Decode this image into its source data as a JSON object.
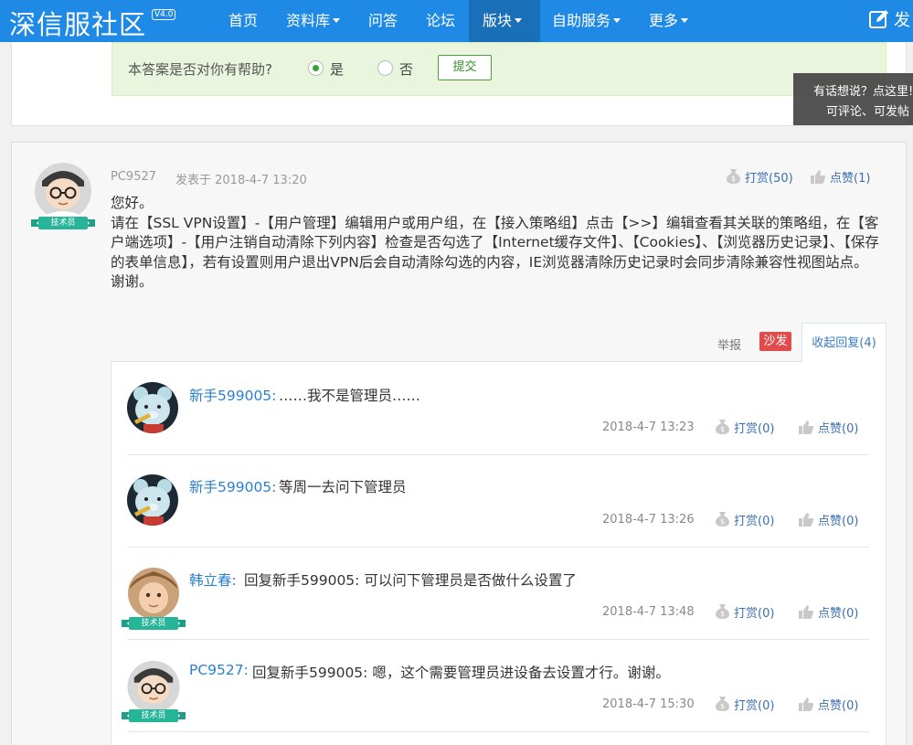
{
  "nav": {
    "logo": "深信服社区",
    "version": "V4.0",
    "items": [
      {
        "label": "首页"
      },
      {
        "label": "资料库"
      },
      {
        "label": "问答"
      },
      {
        "label": "论坛"
      },
      {
        "label": "版块"
      },
      {
        "label": "自助服务"
      },
      {
        "label": "更多"
      }
    ],
    "post_label": "发"
  },
  "helpful": {
    "question": "本答案是否对你有帮助?",
    "yes": "是",
    "no": "否",
    "submit": "提交"
  },
  "side_tip": {
    "line1": "有话想说？点这里!",
    "line2": "可评论、可发帖"
  },
  "answer": {
    "user": "PC9527",
    "posted": "发表于 2018-4-7 13:20",
    "tip": "打赏(50)",
    "like": "点赞(1)",
    "greeting": "您好。",
    "body": "请在【SSL VPN设置】-【用户管理】编辑用户或用户组，在【接入策略组】点击【>>】编辑查看其关联的策略组，在【客户端选项】-【用户注销自动清除下列内容】检查是否勾选了【Internet缓存文件】、【Cookies】、【浏览器历史记录】、【保存的表单信息】，若有设置则用户退出VPN后会自动清除勾选的内容，IE浏览器清除历史记录时会同步清除兼容性视图站点。",
    "closing": "谢谢。",
    "badge": "技术员"
  },
  "reply_bar": {
    "report": "举报",
    "sofa": "沙发",
    "collapse": "收起回复(4)"
  },
  "replies": [
    {
      "name": "新手599005:",
      "text": "……我不是管理员……",
      "time": "2018-4-7 13:23",
      "tip": "打赏(0)",
      "like": "点赞(0)"
    },
    {
      "name": "新手599005:",
      "text": "等周一去问下管理员",
      "time": "2018-4-7 13:26",
      "tip": "打赏(0)",
      "like": "点赞(0)"
    },
    {
      "name": "韩立春:",
      "text": "回复新手599005: 可以问下管理员是否做什么设置了",
      "time": "2018-4-7 13:48",
      "tip": "打赏(0)",
      "like": "点赞(0)",
      "badge": "技术员"
    },
    {
      "name": "PC9527:",
      "text": "回复新手599005: 嗯，这个需要管理员进设备去设置才行。谢谢。",
      "time": "2018-4-7 15:30",
      "tip": "打赏(0)",
      "like": "点赞(0)",
      "badge": "技术员"
    }
  ],
  "colors": {
    "nav_bg": "#1f8ae6",
    "nav_active": "#1a6fb9",
    "link": "#2b7fcf",
    "sofa": "#e14b4b",
    "helpful_bg": "#e9f6dd"
  }
}
